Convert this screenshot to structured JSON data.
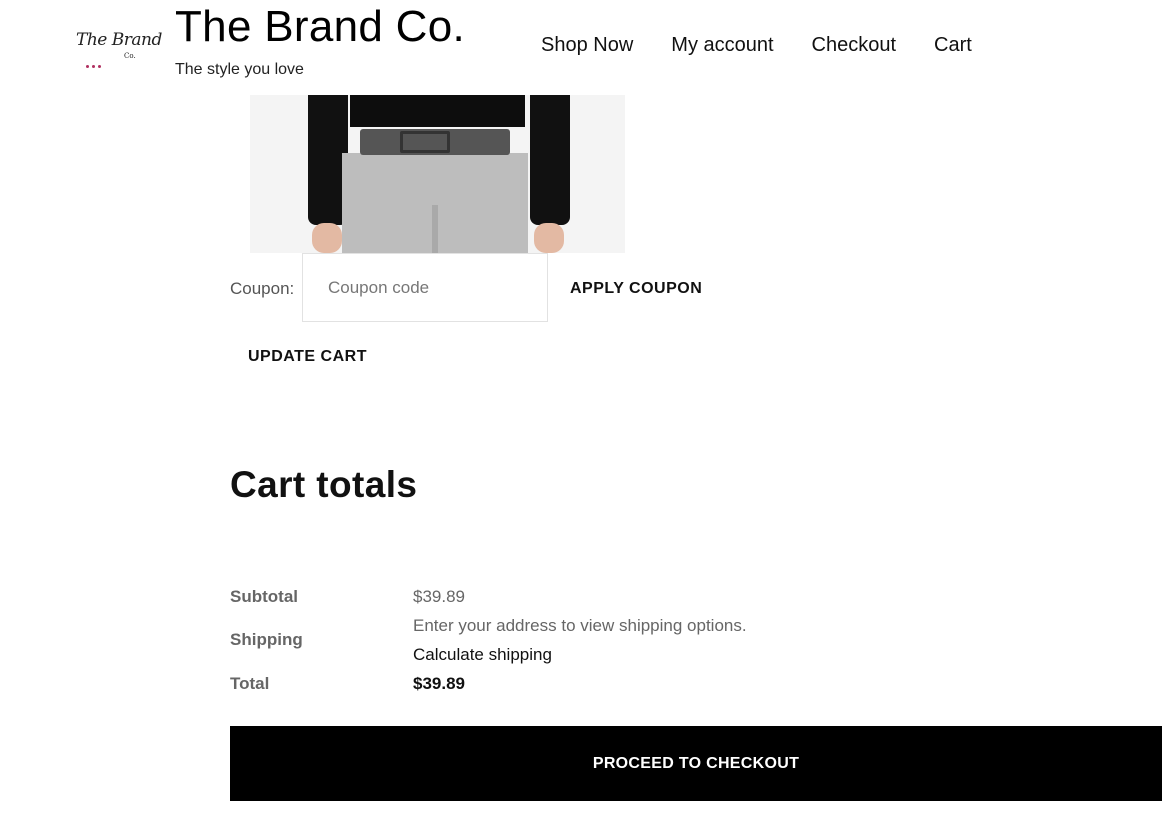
{
  "header": {
    "logo_text": "The Brand",
    "logo_sub": "Co.",
    "site_title": "The Brand Co.",
    "tagline": "The style you love",
    "nav": [
      "Shop Now",
      "My account",
      "Checkout",
      "Cart"
    ]
  },
  "coupon": {
    "label": "Coupon:",
    "placeholder": "Coupon code",
    "apply_label": "APPLY COUPON"
  },
  "cart": {
    "update_label": "UPDATE CART"
  },
  "totals": {
    "title": "Cart totals",
    "subtotal_label": "Subtotal",
    "subtotal_value": "$39.89",
    "shipping_label": "Shipping",
    "shipping_note": "Enter your address to view shipping options.",
    "calculate_shipping": "Calculate shipping",
    "total_label": "Total",
    "total_value": "$39.89",
    "checkout_label": "PROCEED TO CHECKOUT"
  },
  "colors": {
    "checkout_bg": "#000000",
    "muted_text": "#666666"
  }
}
